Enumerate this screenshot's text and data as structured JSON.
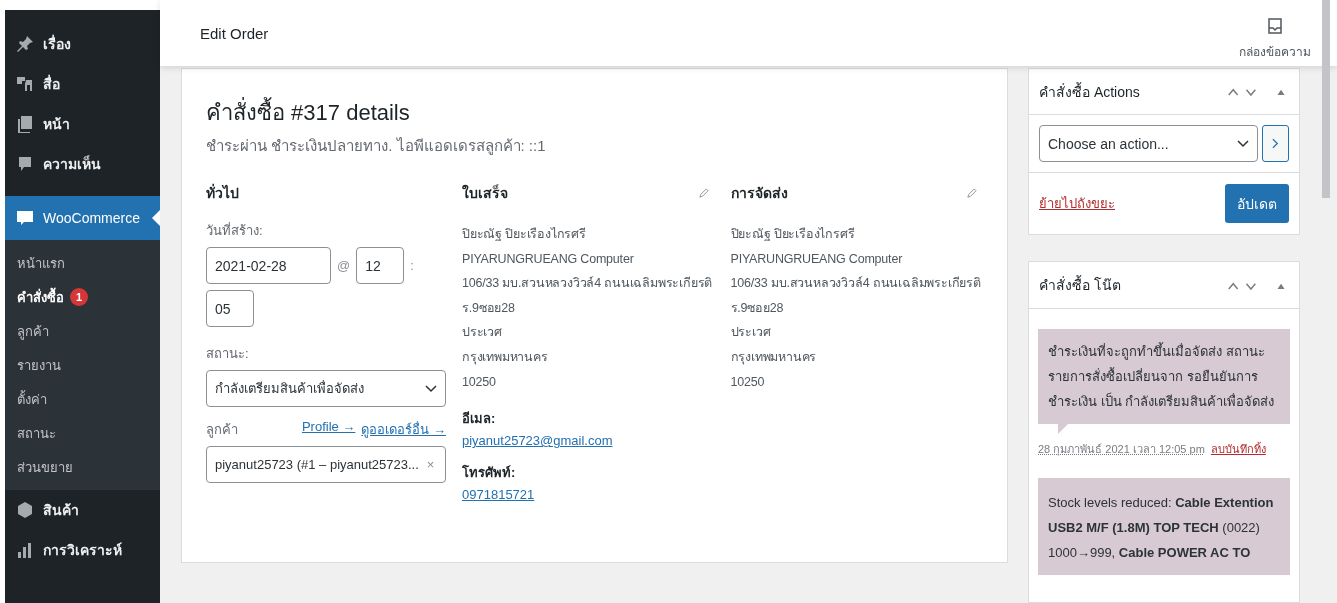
{
  "sidebar": {
    "items": [
      {
        "label": "เรื่อง",
        "kind": "menu"
      },
      {
        "label": "สื่อ",
        "kind": "menu"
      },
      {
        "label": "หน้า",
        "kind": "menu"
      },
      {
        "label": "ความเห็น",
        "kind": "menu"
      },
      {
        "label": "WooCommerce",
        "kind": "current",
        "children": [
          {
            "label": "หน้าแรก",
            "selected": false
          },
          {
            "label": "คำสั่งซื้อ",
            "selected": true,
            "badge": "1"
          },
          {
            "label": "ลูกค้า",
            "selected": false
          },
          {
            "label": "รายงาน",
            "selected": false
          },
          {
            "label": "ตั้งค่า",
            "selected": false
          },
          {
            "label": "สถานะ",
            "selected": false
          },
          {
            "label": "ส่วนขยาย",
            "selected": false
          }
        ]
      },
      {
        "label": "สินค้า",
        "kind": "menu"
      },
      {
        "label": "การวิเคราะห์",
        "kind": "menu"
      }
    ]
  },
  "header": {
    "title": "Edit Order",
    "inbox": "กล่องข้อความ"
  },
  "order": {
    "heading": "คำสั่งซื้อ #317 details",
    "meta": "ชำระผ่าน ชำระเงินปลายทาง. ไอพีแอดเดรสลูกค้า: ::1",
    "general": {
      "heading": "ทั่วไป",
      "date_label": "วันที่สร้าง:",
      "date": "2021-02-28",
      "at": "@",
      "hour": "12",
      "colon": ":",
      "minute": "05",
      "status_label": "สถานะ:",
      "status": "กำลังเตรียมสินค้าเพื่อจัดส่ง",
      "customer_label": "ลูกค้า",
      "links": [
        "Profile →",
        "ดูออเดอร์อื่น →"
      ],
      "customer": "piyanut25723 (#1 – piyanut25723...",
      "clear": "×"
    },
    "billing": {
      "heading": "ใบเสร็จ",
      "address": [
        "ปิยะณัฐ ปิยะเรืองไกรศรี",
        "PIYARUNGRUEANG Computer",
        "106/33 มบ.สวนหลวงวิวล์4 ถนนเฉลิมพระเกียรติ",
        "ร.9ซอย28",
        "ประเวศ",
        "กรุงเทพมหานคร",
        "10250"
      ],
      "email_label": "อีเมล:",
      "email": "piyanut25723@gmail.com",
      "phone_label": "โทรศัพท์:",
      "phone": "0971815721"
    },
    "shipping": {
      "heading": "การจัดส่ง",
      "address": [
        "ปิยะณัฐ ปิยะเรืองไกรศรี",
        "PIYARUNGRUEANG Computer",
        "106/33 มบ.สวนหลวงวิวล์4 ถนนเฉลิมพระเกียรติ",
        "ร.9ซอย28",
        "ประเวศ",
        "กรุงเทพมหานคร",
        "10250"
      ]
    }
  },
  "actions": {
    "title": "คำสั่งซื้อ Actions",
    "select": "Choose an action...",
    "trash": "ย้ายไปถังขยะ",
    "update": "อัปเดต"
  },
  "notes": {
    "title": "คำสั่งซื้อ โน๊ต",
    "items": [
      {
        "text": "ชำระเงินที่จะถูกทำขึ้นเมื่อจัดส่ง สถานะรายการสั่งซื้อเปลี่ยนจาก รอยืนยันการชำระเงิน เป็น กำลังเตรียมสินค้าเพื่อจัดส่ง",
        "date": "28 กุมภาพันธ์ 2021 เวลา 12:05 pm",
        "delete": "ลบบันทึกทิ้ง"
      },
      {
        "text": "Stock levels reduced: **Cable Extention USB2 M/F (1.8M) TOP TECH** (0022) 1000→999, **Cable POWER AC TO**"
      }
    ]
  }
}
